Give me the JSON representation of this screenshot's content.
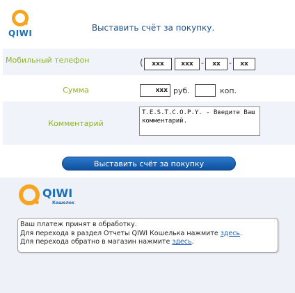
{
  "logo": {
    "text": "QIWI"
  },
  "page_title": "Выставить счёт за покупку.",
  "form": {
    "phone": {
      "label": "Мобильный телефон",
      "open_paren": "(",
      "close_paren": ")",
      "separator": "-",
      "parts": [
        "xxx",
        "xxx",
        "xx",
        "xx"
      ]
    },
    "sum": {
      "label": "Сумма",
      "rubles_value": "xxx",
      "rubles_unit": "руб.",
      "kopecks_value": "",
      "kopecks_unit": "коп."
    },
    "comment": {
      "label": "Комментарий",
      "value": "T.E.S.T.C.O.P.Y. - Введите Ваш комментарий."
    },
    "submit_label": "Выставить счёт за покупку"
  },
  "wallet_logo": {
    "word": "QIWI",
    "sub": "Кошелек"
  },
  "message": {
    "line1": "Ваш платеж принят в обработку.",
    "line2_text": "Для перехода в раздел Отчеты QIWI Кошелька нажмите ",
    "line2_link": "здесь",
    "line2_end": ".",
    "line3_text": "Для перехода обратно в магазин нажмите ",
    "line3_link": "здесь",
    "line3_end": "."
  },
  "colors": {
    "accent_blue": "#1c6fb5",
    "label_green": "#8cb422",
    "logo_orange": "#f6a520"
  }
}
